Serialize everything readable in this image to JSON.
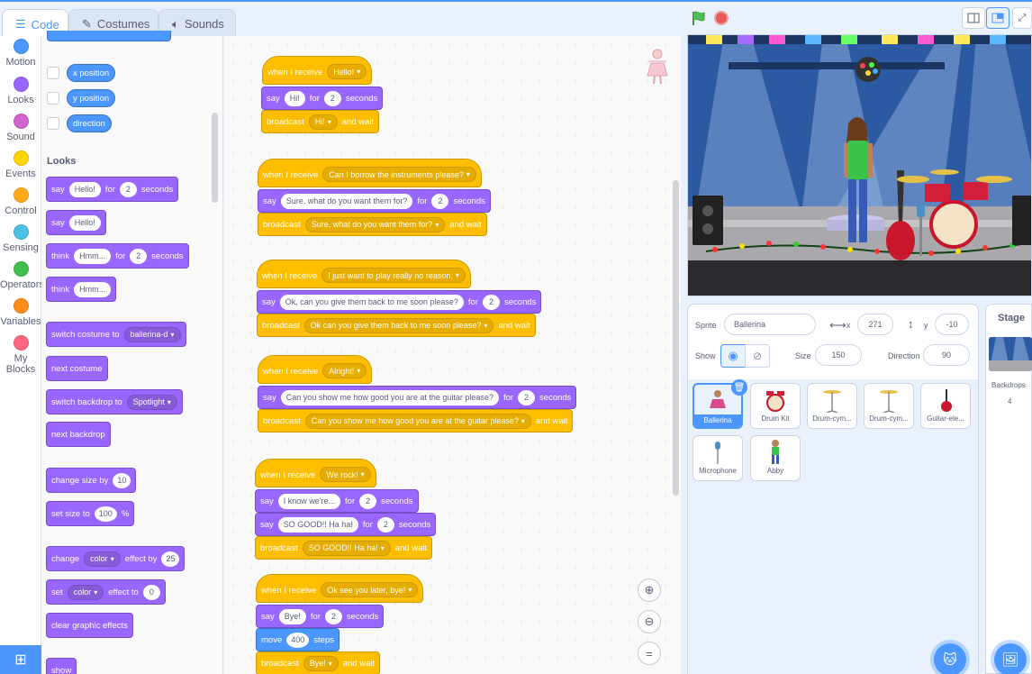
{
  "tabs": [
    {
      "label": "Code",
      "icon": "code-icon"
    },
    {
      "label": "Costumes",
      "icon": "brush-icon"
    },
    {
      "label": "Sounds",
      "icon": "speaker-icon"
    }
  ],
  "categories": [
    {
      "label": "Motion",
      "color": "#4c97ff"
    },
    {
      "label": "Looks",
      "color": "#9966ff"
    },
    {
      "label": "Sound",
      "color": "#cf63cf"
    },
    {
      "label": "Events",
      "color": "#ffd500"
    },
    {
      "label": "Control",
      "color": "#ffab19"
    },
    {
      "label": "Sensing",
      "color": "#4cbfe6"
    },
    {
      "label": "Operators",
      "color": "#40bf4a"
    },
    {
      "label": "Variables",
      "color": "#ff8c1a"
    },
    {
      "label": "My Blocks",
      "color": "#ff6680"
    }
  ],
  "palette": {
    "motion_reporters": [
      "x position",
      "y position",
      "direction"
    ],
    "looks_heading": "Looks",
    "say_for": {
      "say": "say",
      "text": "Hello!",
      "for": "for",
      "secs": "2",
      "seconds": "seconds"
    },
    "say": {
      "say": "say",
      "text": "Hello!"
    },
    "think_for": {
      "think": "think",
      "text": "Hmm...",
      "for": "for",
      "secs": "2",
      "seconds": "seconds"
    },
    "think": {
      "think": "think",
      "text": "Hmm..."
    },
    "switch_costume": {
      "label": "switch costume to",
      "value": "ballerina-d"
    },
    "next_costume": "next costume",
    "switch_backdrop": {
      "label": "switch backdrop to",
      "value": "Spotlight"
    },
    "next_backdrop": "next backdrop",
    "change_size": {
      "label": "change size by",
      "value": "10"
    },
    "set_size": {
      "label": "set size to",
      "value": "100",
      "unit": "%"
    },
    "change_effect": {
      "change": "change",
      "effect": "color",
      "by": "effect by",
      "value": "25"
    },
    "set_effect": {
      "set": "set",
      "effect": "color",
      "to": "effect to",
      "value": "0"
    },
    "clear_effects": "clear graphic effects",
    "show": "show"
  },
  "scripts": [
    {
      "receive": "Hello!",
      "say": "Hi!",
      "secs": "2",
      "broadcast": "Hi!"
    },
    {
      "receive": "Can I borrow the instruments please?",
      "say": "Sure, what do you want them for?",
      "secs": "2",
      "broadcast": "Sure, what do you want them for?"
    },
    {
      "receive": "I just want to play really no reason.",
      "say": "Ok, can you give them back to me soon please?",
      "secs": "2",
      "broadcast": "Ok can you give them back to me soon please?"
    },
    {
      "receive": "Alright!",
      "say": "Can you show me how good you are at the guitar please?",
      "secs": "2",
      "broadcast": "Can you show me how good you are at the guitar please?"
    },
    {
      "receive": "We rock!",
      "say": "I know we're...",
      "secs": "2",
      "say2": "SO GOOD!! Ha ha!",
      "secs2": "2",
      "broadcast": "SO GOOD!! Ha ha!"
    },
    {
      "receive": "Ok see you later, bye!",
      "say": "Bye!",
      "secs": "2",
      "move": "400",
      "broadcast": "Bye!"
    }
  ],
  "block_words": {
    "when_receive": "when I receive",
    "say": "say",
    "for": "for",
    "seconds": "seconds",
    "broadcast": "broadcast",
    "and_wait": "and wait",
    "move": "move",
    "steps": "steps"
  },
  "sprite_info": {
    "sprite_label": "Sprite",
    "sprite_name": "Ballerina",
    "x_label": "x",
    "x": "271",
    "y_label": "y",
    "y": "-10",
    "show_label": "Show",
    "size_label": "Size",
    "size": "150",
    "direction_label": "Direction",
    "direction": "90"
  },
  "sprites": [
    {
      "name": "Ballerina",
      "selected": true
    },
    {
      "name": "Drum Kit"
    },
    {
      "name": "Drum-cym..."
    },
    {
      "name": "Drum-cym..."
    },
    {
      "name": "Guitar-ele..."
    },
    {
      "name": "Microphone"
    },
    {
      "name": "Abby"
    }
  ],
  "stage_panel": {
    "title": "Stage",
    "backdrops_label": "Backdrops",
    "backdrops_count": "4"
  }
}
